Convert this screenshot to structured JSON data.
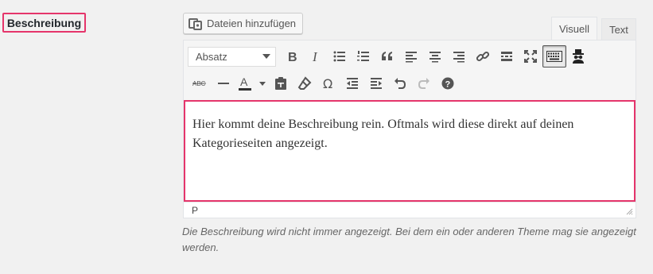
{
  "field": {
    "label": "Beschreibung"
  },
  "media": {
    "add_label": "Dateien hinzufügen"
  },
  "tabs": [
    {
      "label": "Visuell",
      "active": true
    },
    {
      "label": "Text",
      "active": false
    }
  ],
  "toolbar": {
    "format_select": "Absatz",
    "row1": [
      "bold-icon",
      "italic-icon",
      "bullet-list-icon",
      "numbered-list-icon",
      "blockquote-icon",
      "align-left-icon",
      "align-center-icon",
      "align-right-icon",
      "link-icon",
      "read-more-icon",
      "fullscreen-icon",
      "toolbar-toggle-icon",
      "spy-icon"
    ],
    "row2": [
      "strikethrough-icon",
      "horizontal-rule-icon",
      "text-color-icon",
      "paste-text-icon",
      "clear-formatting-icon",
      "special-character-icon",
      "outdent-icon",
      "indent-icon",
      "undo-icon",
      "redo-icon",
      "help-icon"
    ]
  },
  "editor": {
    "content": "Hier kommt deine Beschreibung rein. Oftmals wird diese direkt auf deinen Kategorieseiten angezeigt.",
    "status_path": "P"
  },
  "description": "Die Beschreibung wird nicht immer angezeigt. Bei dem ein oder anderen Theme mag sie angezeigt werden.",
  "colors": {
    "highlight": "#e5356b",
    "background": "#f1f1f1"
  }
}
